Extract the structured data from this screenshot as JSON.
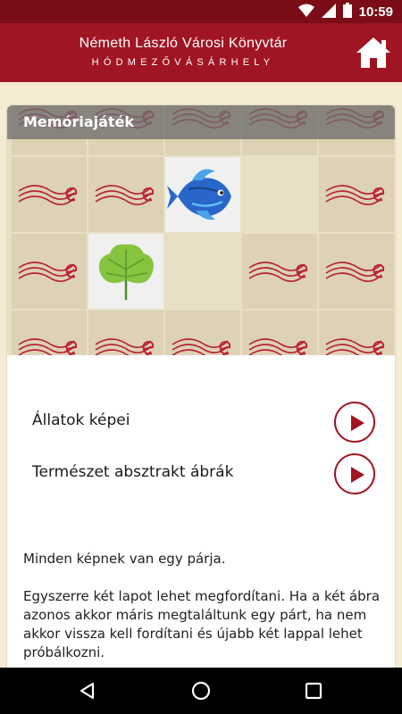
{
  "status": {
    "time": "10:59"
  },
  "header": {
    "title": "Németh László Városi Könyvtár",
    "subtitle": "HÓDMEZŐVÁSÁRHELY",
    "home_icon": "home-icon"
  },
  "game": {
    "title": "Memóriajáték",
    "tile_states": [
      [
        "back",
        "back",
        "back",
        "back",
        "back"
      ],
      [
        "back",
        "back",
        "fish",
        "empty",
        "back"
      ],
      [
        "back",
        "leaf",
        "empty",
        "back",
        "back"
      ],
      [
        "back",
        "back",
        "back",
        "back",
        "back"
      ]
    ]
  },
  "options": [
    {
      "label": "Állatok képei",
      "icon": "play-icon"
    },
    {
      "label": "Természet absztrakt ábrák",
      "icon": "play-icon"
    }
  ],
  "description": [
    "Minden képnek van egy párja.",
    "Egyszerre két lapot lehet megfordítani. Ha a két ábra azonos akkor máris megtaláltunk egy párt, ha nem akkor vissza kell fordítani és újabb két lappal lehet próbálkozni."
  ],
  "colors": {
    "brand": "#a01523",
    "status_bar": "#7a0d17",
    "background": "#f6ecd3"
  }
}
